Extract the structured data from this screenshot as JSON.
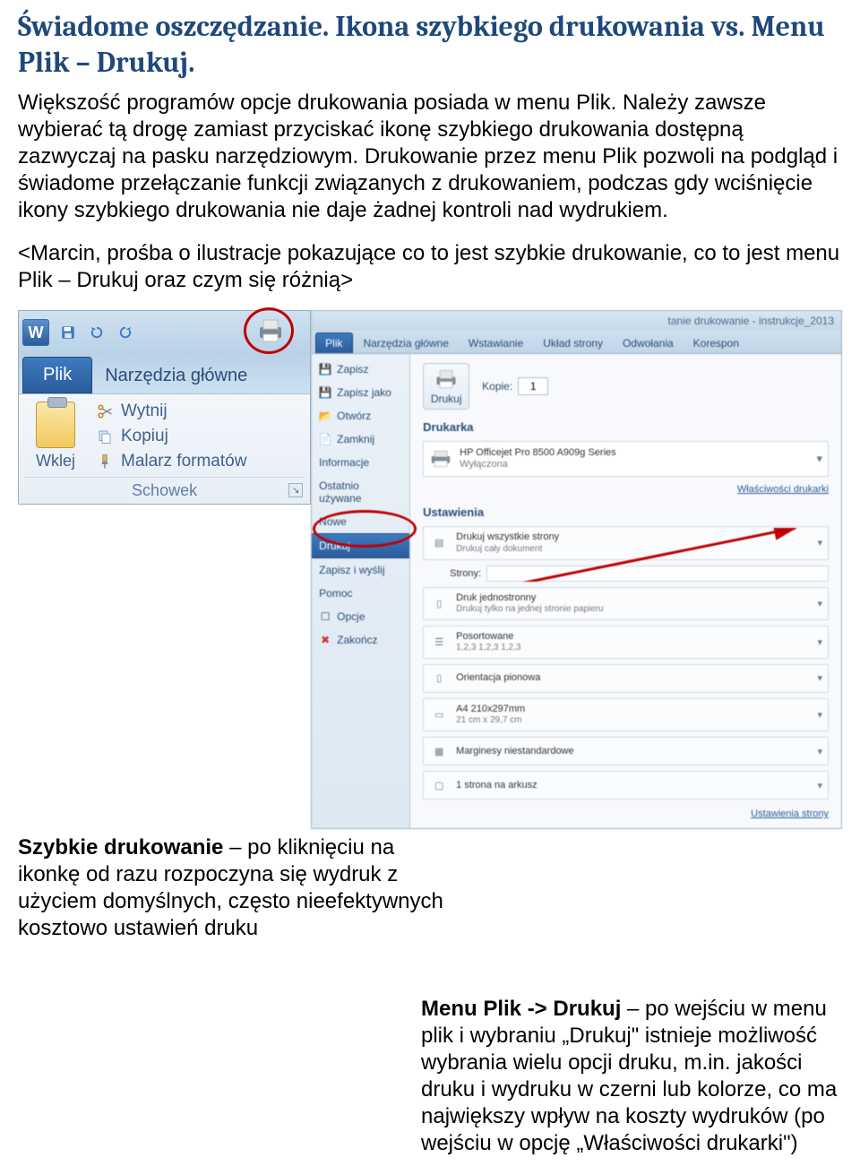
{
  "title": "Świadome oszczędzanie. Ikona szybkiego drukowania vs. Menu Plik – Drukuj.",
  "para1": "Większość programów opcje drukowania posiada w menu Plik. Należy zawsze wybierać tą drogę zamiast przyciskać ikonę szybkiego drukowania dostępną zazwyczaj na pasku narzędziowym. Drukowanie przez menu Plik pozwoli na podgląd i świadome przełączanie funkcji związanych z drukowaniem, podczas gdy wciśnięcie ikony szybkiego drukowania nie daje żadnej kontroli nad wydrukiem.",
  "para2": "<Marcin, prośba o ilustracje pokazujące co to jest szybkie drukowanie, co to jest menu Plik – Drukuj oraz czym się różnią>",
  "left": {
    "tabPlik": "Plik",
    "tabHome": "Narzędzia główne",
    "paste": "Wklej",
    "cut": "Wytnij",
    "copy": "Kopiuj",
    "painter": "Malarz formatów",
    "group": "Schowek"
  },
  "right": {
    "titlebar": "tanie drukowanie - instrukcje_2013",
    "tabs": {
      "plik": "Plik",
      "home": "Narzędzia główne",
      "wstaw": "Wstawianie",
      "uklad": "Układ strony",
      "odw": "Odwołania",
      "kor": "Korespon"
    },
    "nav": {
      "zapisz": "Zapisz",
      "zapiszjako": "Zapisz jako",
      "otworz": "Otwórz",
      "zamknij": "Zamknij",
      "informacje": "Informacje",
      "ostatnio": "Ostatnio używane",
      "nowe": "Nowe",
      "drukuj": "Drukuj",
      "zapiszwyslij": "Zapisz i wyślij",
      "pomoc": "Pomoc",
      "opcje": "Opcje",
      "zakoncz": "Zakończ"
    },
    "print": {
      "btn": "Drukuj",
      "kopieLabel": "Kopie:",
      "kopieVal": "1",
      "drukarkaLabel": "Drukarka",
      "printerName": "HP Officejet Pro 8500 A909g Series",
      "printerStatus": "Wyłączona",
      "propsLink": "Właściwości drukarki",
      "ustLabel": "Ustawienia",
      "s1a": "Drukuj wszystkie strony",
      "s1b": "Drukuj cały dokument",
      "stronyLabel": "Strony:",
      "s2a": "Druk jednostronny",
      "s2b": "Drukuj tylko na jednej stronie papieru",
      "s3a": "Posortowane",
      "s3b": "1,2,3   1,2,3   1,2,3",
      "s4a": "Orientacja pionowa",
      "s5a": "A4 210x297mm",
      "s5b": "21 cm x 29,7 cm",
      "s6a": "Marginesy niestandardowe",
      "s7a": "1 strona na arkusz",
      "pageSetup": "Ustawienia strony"
    }
  },
  "captionLeftBold": "Szybkie drukowanie",
  "captionLeftRest": " – po kliknięciu na ikonkę od razu rozpoczyna się wydruk z użyciem domyślnych, często nieefektywnych kosztowo ustawień druku",
  "captionRightBold": "Menu Plik -> Drukuj",
  "captionRightRest": " – po wejściu w menu plik i wybraniu „Drukuj\" istnieje możliwość wybrania wielu opcji druku, m.in. jakości druku i wydruku w czerni lub kolorze, co ma największy wpływ na koszty wydruków (po wejściu w opcję „Właściwości drukarki\")"
}
